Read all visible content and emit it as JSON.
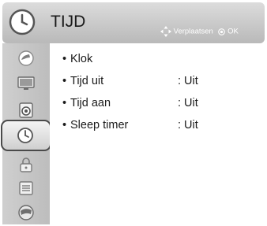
{
  "header": {
    "title": "TIJD",
    "icon": "clock-icon",
    "help": {
      "move_label": "Verplaatsen",
      "ok_label": "OK"
    }
  },
  "sidebar": {
    "items": [
      {
        "icon": "picture-icon",
        "selected": false
      },
      {
        "icon": "tv-screen-icon",
        "selected": false
      },
      {
        "icon": "speaker-icon",
        "selected": false
      },
      {
        "icon": "clock-icon",
        "selected": true
      },
      {
        "icon": "lock-icon",
        "selected": false
      },
      {
        "icon": "option-icon",
        "selected": false
      },
      {
        "icon": "network-icon",
        "selected": false
      }
    ]
  },
  "menu": {
    "items": [
      {
        "label": "Klok",
        "value": ""
      },
      {
        "label": "Tijd uit",
        "value": ": Uit"
      },
      {
        "label": "Tijd aan",
        "value": ": Uit"
      },
      {
        "label": "Sleep timer",
        "value": ": Uit"
      }
    ]
  },
  "colors": {
    "header_gradient_top": "#dcdcdc",
    "header_gradient_bottom": "#b9b9b9",
    "sidebar": "#c6c6c6",
    "text": "#1a1a1a"
  }
}
